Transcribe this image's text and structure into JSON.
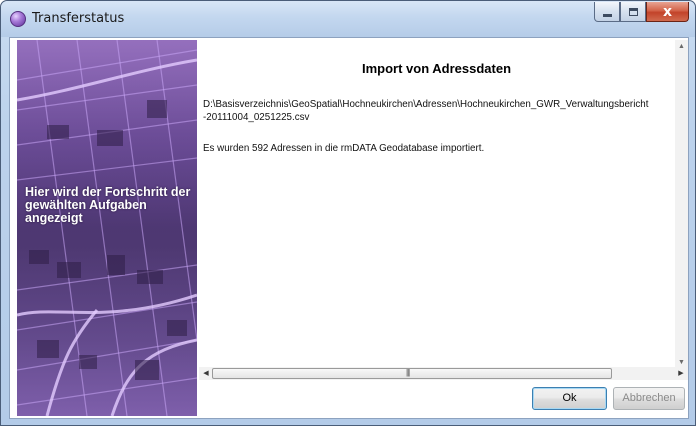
{
  "window": {
    "title": "Transferstatus",
    "close_glyph": "x"
  },
  "banner": {
    "text": "Hier wird der Fortschritt der gewählten Aufgaben angezeigt"
  },
  "content": {
    "heading": "Import von Adressdaten",
    "path_line1": "D:\\Basisverzeichnis\\GeoSpatial\\Hochneukirchen\\Adressen\\Hochneukirchen_GWR_Verwaltungsbericht",
    "path_line2": "-20111004_0251225.csv",
    "message": "Es wurden 592 Adressen in die rmDATA Geodatabase importiert."
  },
  "buttons": {
    "ok_label": "Ok",
    "cancel_label": "Abbrechen"
  },
  "colors": {
    "accent": "#5d2f98",
    "close": "#c2432a"
  }
}
